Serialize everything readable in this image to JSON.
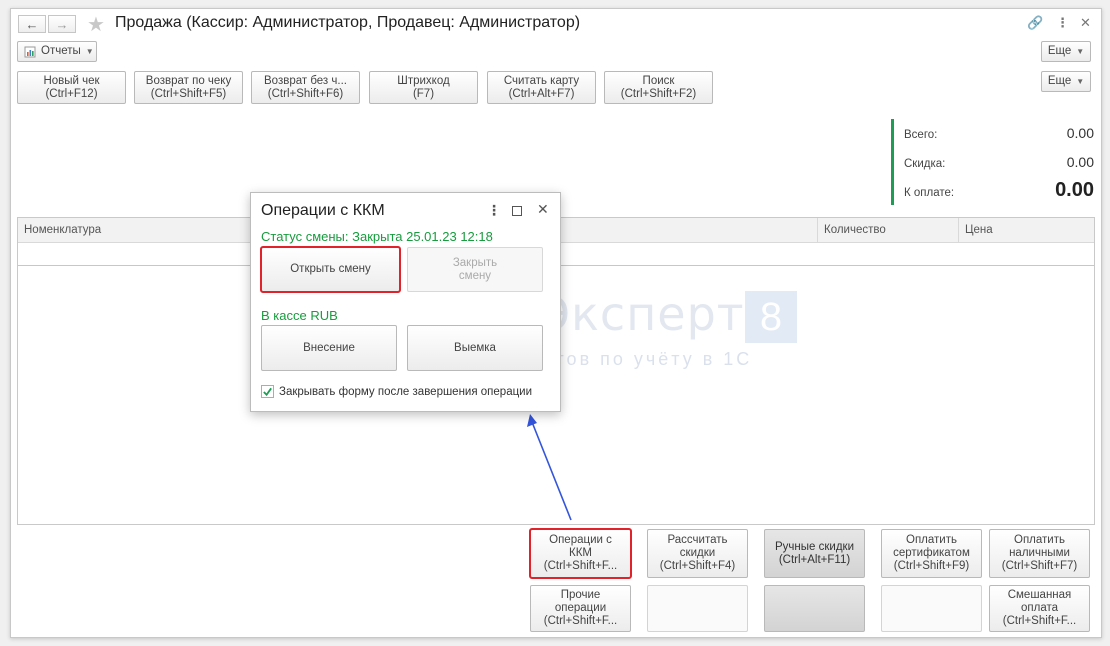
{
  "window": {
    "title": "Продажа (Кассир: Администратор, Продавец: Администратор)",
    "icons": [
      "back-arrow-icon",
      "forward-arrow-icon",
      "star-icon",
      "link-icon",
      "more-vertical-icon",
      "close-icon"
    ]
  },
  "toolbar": {
    "reports_label": "Отчеты",
    "more_label": "Еще"
  },
  "actions": {
    "buttons": [
      "Новый чек\n(Ctrl+F12)",
      "Возврат по чеку\n(Ctrl+Shift+F5)",
      "Возврат без ч...\n(Ctrl+Shift+F6)",
      "Штрихкод\n(F7)",
      "Считать карту\n(Ctrl+Alt+F7)",
      "Поиск\n(Ctrl+Shift+F2)"
    ],
    "more_label": "Еще"
  },
  "totals": {
    "total_label": "Всего:",
    "total_value": "0.00",
    "discount_label": "Скидка:",
    "discount_value": "0.00",
    "to_pay_label": "К оплате:",
    "to_pay_value": "0.00",
    "accent_color": "#1f9d55"
  },
  "table": {
    "columns": [
      "Номенклатура",
      "Количество",
      "Цена"
    ]
  },
  "watermark": {
    "brand": "БухЭксперт",
    "number": "8",
    "subtitle": "База ответов по учёту в 1С"
  },
  "dialog": {
    "title": "Операции с ККМ",
    "status": "Статус смены: Закрыта 25.01.23 12:18",
    "open_shift": "Открыть смену",
    "close_shift": "Закрыть\nсмену",
    "cash_label": "В кассе  RUB",
    "deposit": "Внесение",
    "withdraw": "Выемка",
    "close_form_label": "Закрывать форму после завершения операции",
    "close_form_checked": true,
    "status_color": "#179c3e"
  },
  "bottom": {
    "row1": [
      "Операции с\nККМ\n(Ctrl+Shift+F...",
      "Рассчитать\nскидки\n(Ctrl+Shift+F4)",
      "Ручные скидки\n(Ctrl+Alt+F11)",
      "Оплатить\nсертификатом\n(Ctrl+Shift+F9)",
      "Оплатить\nналичными\n(Ctrl+Shift+F7)"
    ],
    "row2": [
      "Прочие\nоперации\n(Ctrl+Shift+F...",
      "",
      "",
      "",
      "Смешанная\nоплата\n(Ctrl+Shift+F..."
    ]
  },
  "highlight_color": "#e0232b",
  "arrow_color": "#3355dd"
}
